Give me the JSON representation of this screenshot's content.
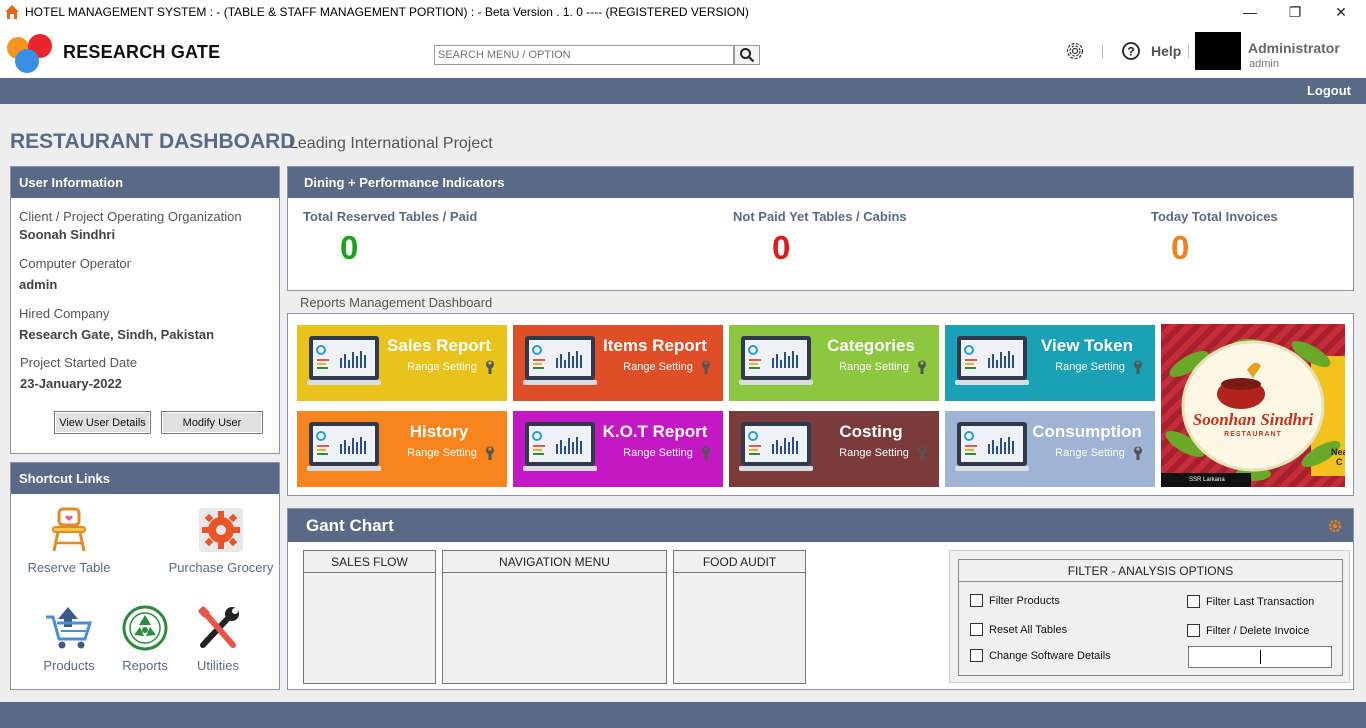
{
  "window": {
    "title": "HOTEL MANAGEMENT SYSTEM : - (TABLE & STAFF MANAGEMENT PORTION) : -  Beta Version . 1. 0 ---- (REGISTERED VERSION)",
    "minimize": "—",
    "maximize": "❐",
    "close": "✕"
  },
  "header": {
    "brand": "RESEARCH GATE",
    "search_placeholder": "SEARCH MENU / OPTION",
    "help": "Help",
    "user_name": "Administrator",
    "user_role": "admin"
  },
  "nav": {
    "logout": "Logout"
  },
  "page": {
    "title": "RESTAURANT DASHBOARD",
    "subtitle": "Leading International Project"
  },
  "user_info": {
    "heading": "User Information",
    "client_label": "Client / Project Operating Organization",
    "client_value": "Soonah Sindhri",
    "operator_label": "Computer Operator",
    "operator_value": "admin",
    "company_label": "Hired Company",
    "company_value": "Research Gate, Sindh, Pakistan",
    "started_label": "Project Started Date",
    "started_value": "23-January-2022",
    "view_button": "View User Details",
    "modify_button": "Modify User"
  },
  "shortcuts": {
    "heading": "Shortcut Links",
    "items": [
      "Reserve Table",
      "Purchase Grocery",
      "Products",
      "Reports",
      "Utilities"
    ]
  },
  "kpis": {
    "heading": "Dining  +  Performance Indicators",
    "items": [
      {
        "label": "Total Reserved Tables / Paid",
        "value": "0",
        "color": "#1aa31a"
      },
      {
        "label": "Not Paid Yet Tables / Cabins",
        "value": "0",
        "color": "#e01b1b"
      },
      {
        "label": "Today Total Invoices",
        "value": "0",
        "color": "#f08020"
      }
    ]
  },
  "reports": {
    "caption": "Reports Management Dashboard",
    "tiles": [
      {
        "name": "Sales Report",
        "sub": "Range Setting",
        "color": "#e9c21b"
      },
      {
        "name": "Items Report",
        "sub": "Range Setting",
        "color": "#e04e28"
      },
      {
        "name": "Categories",
        "sub": "Range Setting",
        "color": "#8dc63f"
      },
      {
        "name": "View Token",
        "sub": "Range Setting",
        "color": "#1ba1b5"
      },
      {
        "name": "History",
        "sub": "Range Setting",
        "color": "#f7841c"
      },
      {
        "name": "K.O.T Report",
        "sub": "Range Setting",
        "color": "#c318c3"
      },
      {
        "name": "Costing",
        "sub": "Range Setting",
        "color": "#7b3b3b"
      },
      {
        "name": "Consumption",
        "sub": "Range Setting",
        "color": "#9fb4d4"
      }
    ],
    "promo": {
      "brand": "Soonhan Sindhri",
      "tagline": "RESTAURANT",
      "side_text": "Nea",
      "side_text2": "C",
      "footer_text": "SSR Larkana"
    }
  },
  "gant": {
    "heading": "Gant Chart",
    "boxes": [
      "SALES  FLOW",
      "NAVIGATION MENU",
      "FOOD AUDIT"
    ],
    "filter": {
      "title": "FILTER - ANALYSIS OPTIONS",
      "options": [
        "Filter Products",
        "Reset All Tables",
        "Change Software Details",
        "Filter Last Transaction",
        "Filter / Delete Invoice"
      ]
    }
  }
}
